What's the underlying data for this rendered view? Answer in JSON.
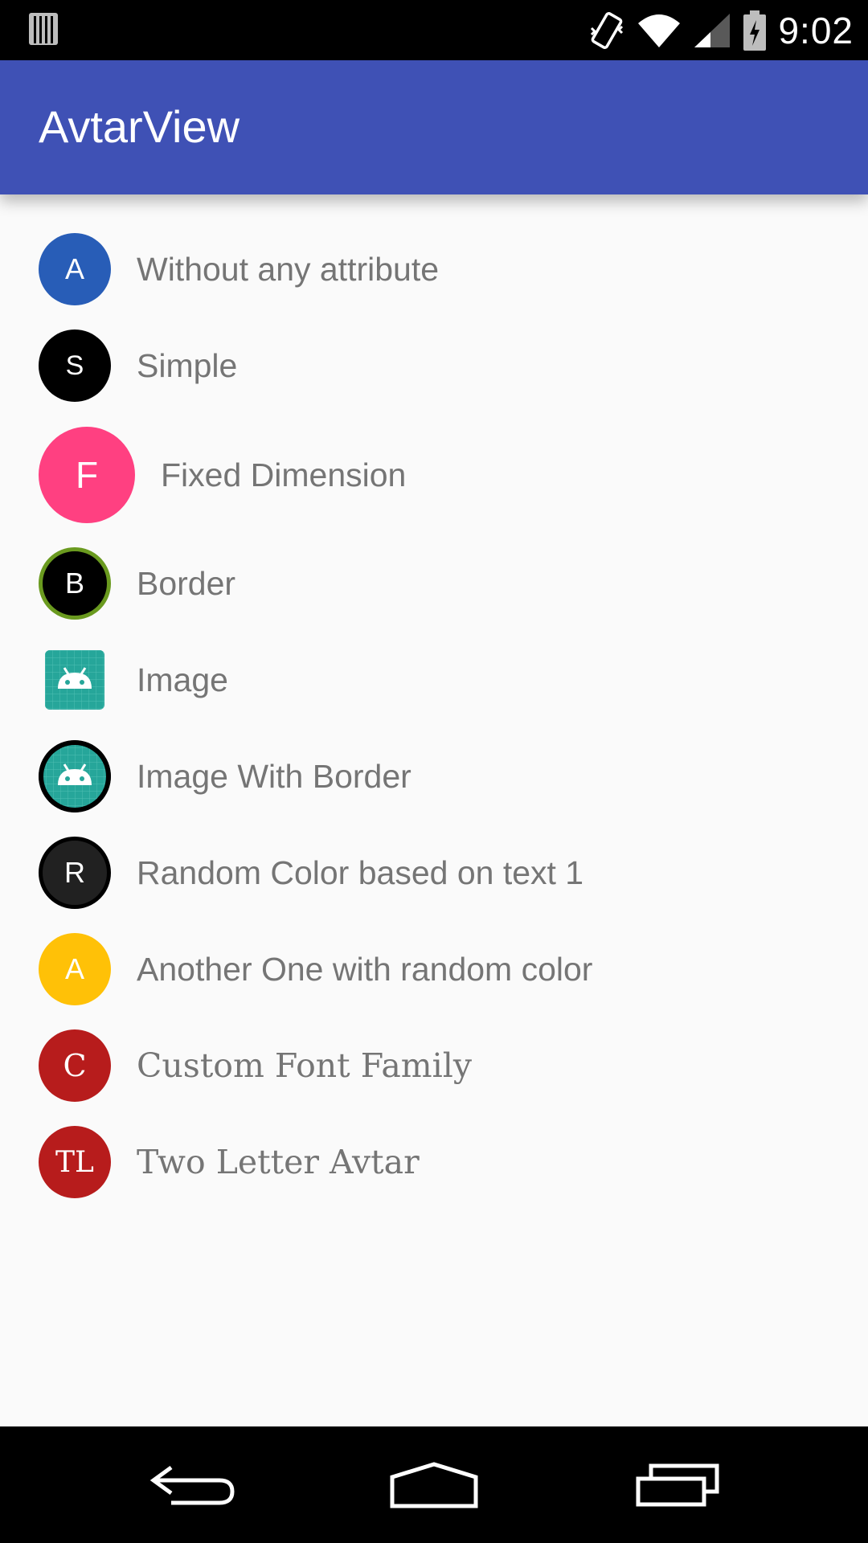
{
  "status_bar": {
    "time": "9:02",
    "icons": [
      "storage-icon",
      "vibrate-icon",
      "wifi-icon",
      "signal-icon",
      "battery-icon"
    ]
  },
  "app_bar": {
    "title": "AvtarView",
    "color": "#3f51b5"
  },
  "items": [
    {
      "initials": "A",
      "label": "Without any attribute",
      "color": "#285db7"
    },
    {
      "initials": "S",
      "label": "Simple",
      "color": "#000000"
    },
    {
      "initials": "F",
      "label": "Fixed Dimension",
      "color": "#ff4081"
    },
    {
      "initials": "B",
      "label": "Border",
      "color": "#000000",
      "border_color": "#6a9a1f"
    },
    {
      "initials": "",
      "label": "Image",
      "icon": "android-icon"
    },
    {
      "initials": "",
      "label": "Image With Border",
      "icon": "android-icon",
      "border_color": "#000000"
    },
    {
      "initials": "R",
      "label": "Random Color based on text 1",
      "color": "#212121",
      "border_color": "#000000"
    },
    {
      "initials": "A",
      "label": "Another One with random color",
      "color": "#ffc107"
    },
    {
      "initials": "C",
      "label": "Custom Font Family",
      "color": "#b71c1c"
    },
    {
      "initials": "TL",
      "label": "Two Letter Avtar",
      "color": "#b71c1c"
    }
  ],
  "nav_bar": {
    "icons": [
      "back-icon",
      "home-icon",
      "recents-icon"
    ]
  }
}
